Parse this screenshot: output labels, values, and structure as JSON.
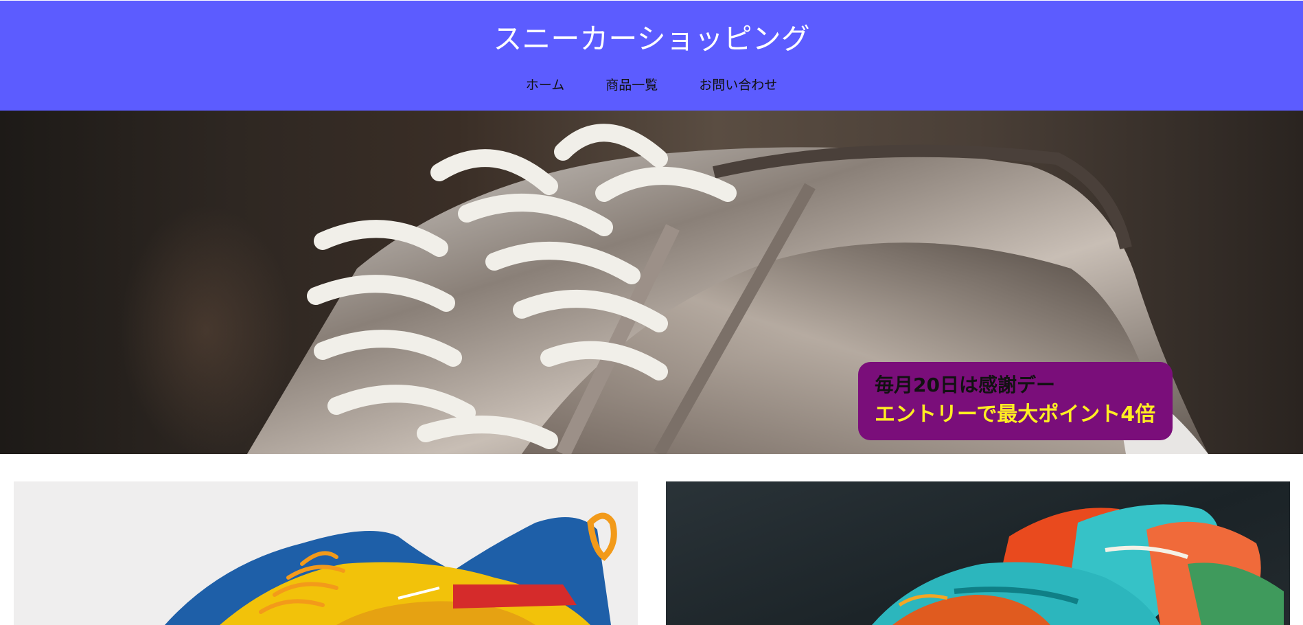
{
  "header": {
    "site_title": "スニーカーショッピング",
    "nav": [
      {
        "label": "ホーム"
      },
      {
        "label": "商品一覧"
      },
      {
        "label": "お問い合わせ"
      }
    ]
  },
  "hero": {
    "promo": {
      "line1": "毎月20日は感謝デー",
      "line2": "エントリーで最大ポイント4倍"
    }
  },
  "products": [
    {
      "image_desc": "sneaker-image"
    },
    {
      "image_desc": "sneaker-image"
    }
  ],
  "colors": {
    "header_bg": "#5c5cff",
    "promo_bg": "#7a0e7a",
    "promo_highlight": "#ffee22"
  }
}
